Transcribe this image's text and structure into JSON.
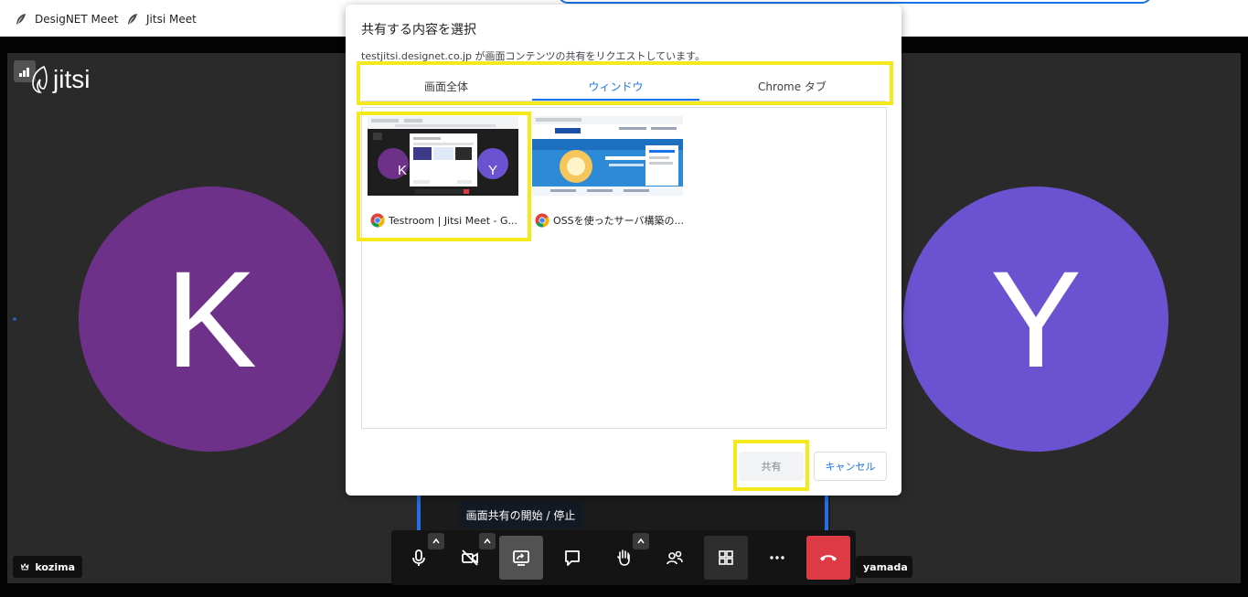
{
  "bookmarks": [
    {
      "label": "DesigNET Meet",
      "icon": "feather-icon"
    },
    {
      "label": "Jitsi Meet",
      "icon": "feather-icon"
    }
  ],
  "logo": {
    "text": "jitsi"
  },
  "participants": {
    "left": {
      "initial": "K",
      "name": "kozima",
      "color": "#6e3189"
    },
    "right": {
      "initial": "Y",
      "name": "yamada",
      "color": "#6a52d0"
    }
  },
  "tooltip": {
    "text": "画面共有の開始 / 停止"
  },
  "toolbar": {
    "buttons": [
      "microphone-icon",
      "camera-off-icon",
      "screen-share-icon",
      "chat-icon",
      "raise-hand-icon",
      "participants-icon",
      "tile-view-icon",
      "more-icon",
      "hangup-icon"
    ]
  },
  "dialog": {
    "title": "共有する内容を選択",
    "subtitle": "testjitsi.designet.co.jp が画面コンテンツの共有をリクエストしています。",
    "tabs": [
      {
        "label": "画面全体",
        "selected": false
      },
      {
        "label": "ウィンドウ",
        "selected": true
      },
      {
        "label": "Chrome タブ",
        "selected": false
      }
    ],
    "windows": [
      {
        "title": "Testroom | Jitsi Meet - G...",
        "thumb_initials": [
          "K",
          "Y"
        ]
      },
      {
        "title": "OSSを使ったサーバ構築の..."
      }
    ],
    "share_label": "共有",
    "cancel_label": "キャンセル"
  },
  "colors": {
    "accent": "#1a73e8",
    "highlight": "#f4e91a",
    "hangup": "#dd3a46"
  }
}
